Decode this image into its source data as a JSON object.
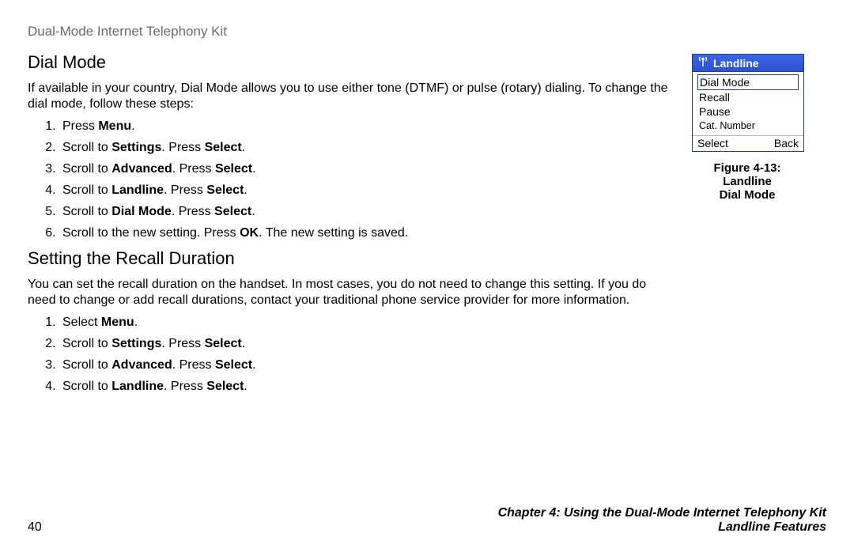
{
  "header": "Dual-Mode Internet Telephony Kit",
  "section1": {
    "title": "Dial Mode",
    "intro": "If available in your country, Dial Mode allows you to use either tone (DTMF) or pulse (rotary) dialing. To change the dial mode, follow these steps:",
    "steps": [
      {
        "pre": "Press ",
        "b1": "Menu",
        "post": "."
      },
      {
        "pre": "Scroll to ",
        "b1": "Settings",
        "mid": ". Press ",
        "b2": "Select",
        "post": "."
      },
      {
        "pre": "Scroll to ",
        "b1": "Advanced",
        "mid": ". Press ",
        "b2": "Select",
        "post": "."
      },
      {
        "pre": "Scroll to ",
        "b1": "Landline",
        "mid": ". Press ",
        "b2": "Select",
        "post": "."
      },
      {
        "pre": "Scroll to ",
        "b1": "Dial Mode",
        "mid": ". Press ",
        "b2": "Select",
        "post": "."
      },
      {
        "pre": "Scroll to the new setting. Press ",
        "b1": "OK",
        "post": ". The new setting is saved."
      }
    ]
  },
  "section2": {
    "title": "Setting the Recall Duration",
    "intro": "You can set the recall duration on the handset. In most cases, you do not need to change this setting. If you do need to change or add recall durations, contact your traditional phone service provider for more information.",
    "steps": [
      {
        "pre": "Select ",
        "b1": "Menu",
        "post": "."
      },
      {
        "pre": "Scroll to ",
        "b1": "Settings",
        "mid": ". Press ",
        "b2": "Select",
        "post": "."
      },
      {
        "pre": "Scroll to ",
        "b1": "Advanced",
        "mid": ". Press ",
        "b2": "Select",
        "post": "."
      },
      {
        "pre": "Scroll to ",
        "b1": "Landline",
        "mid": ". Press ",
        "b2": "Select",
        "post": "."
      }
    ]
  },
  "figure": {
    "header": "Landline",
    "items": [
      "Dial Mode",
      "Recall",
      "Pause",
      "Cat. Number"
    ],
    "footer_left": "Select",
    "footer_right": "Back",
    "caption_line1": "Figure 4-13: Landline",
    "caption_line2": "Dial Mode"
  },
  "footer": {
    "page_num": "40",
    "chapter": "Chapter 4: Using the Dual-Mode Internet Telephony Kit",
    "section": "Landline Features"
  }
}
